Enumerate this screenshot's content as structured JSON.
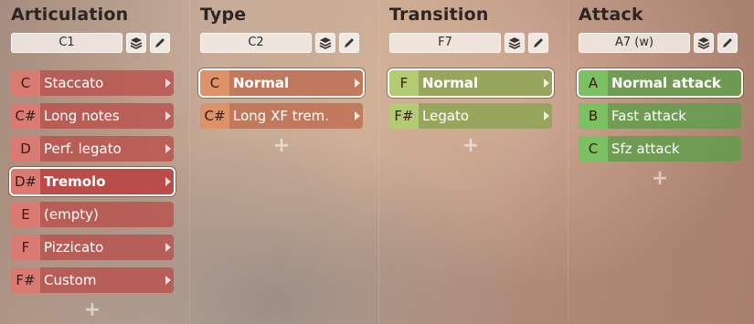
{
  "columns": [
    {
      "title": "Articulation",
      "key": "C1",
      "items": [
        {
          "note": "C",
          "label": "Staccato"
        },
        {
          "note": "C#",
          "label": "Long notes"
        },
        {
          "note": "D",
          "label": "Perf. legato"
        },
        {
          "note": "D#",
          "label": "Tremolo",
          "selected": true
        },
        {
          "note": "E",
          "label": "(empty)"
        },
        {
          "note": "F",
          "label": "Pizzicato"
        },
        {
          "note": "F#",
          "label": "Custom"
        }
      ],
      "add_label": "+"
    },
    {
      "title": "Type",
      "key": "C2",
      "items": [
        {
          "note": "C",
          "label": "Normal",
          "selected": true
        },
        {
          "note": "C#",
          "label": "Long XF trem."
        }
      ],
      "add_label": "+"
    },
    {
      "title": "Transition",
      "key": "F7",
      "items": [
        {
          "note": "F",
          "label": "Normal",
          "selected": true
        },
        {
          "note": "F#",
          "label": "Legato"
        }
      ],
      "add_label": "+"
    },
    {
      "title": "Attack",
      "key": "A7 (w)",
      "items": [
        {
          "note": "A",
          "label": "Normal attack",
          "selected": true
        },
        {
          "note": "B",
          "label": "Fast attack"
        },
        {
          "note": "C",
          "label": "Sfz attack"
        }
      ],
      "add_label": "+"
    }
  ],
  "icons": {
    "layers": "layers-icon",
    "edit": "pencil-icon",
    "submenu": "chevron-right-icon"
  },
  "colors": {
    "articulation": "#ba4e4a",
    "type": "#be6e50",
    "transition": "#8ea454",
    "attack": "#649c4c"
  }
}
